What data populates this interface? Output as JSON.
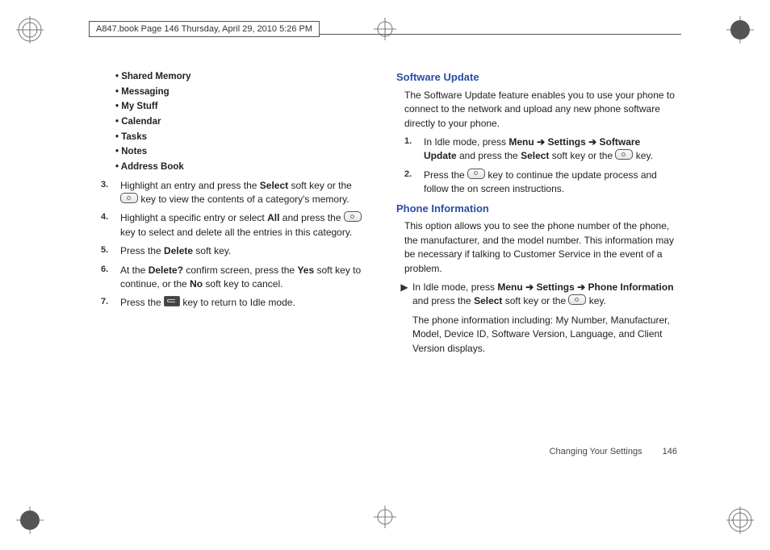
{
  "header": "A847.book  Page 146  Thursday, April 29, 2010  5:26 PM",
  "left": {
    "bullets": [
      "Shared Memory",
      "Messaging",
      "My Stuff",
      "Calendar",
      "Tasks",
      "Notes",
      "Address Book"
    ],
    "steps": {
      "s3": {
        "n": "3.",
        "a": "Highlight an entry and press the ",
        "b": "Select",
        "c": " soft key or the ",
        "d": " key to view the contents of a category's memory."
      },
      "s4": {
        "n": "4.",
        "a": "Highlight a specific entry or select ",
        "b": "All",
        "c": " and press the ",
        "d": " key to select and delete all the entries in this category."
      },
      "s5": {
        "n": "5.",
        "a": "Press the ",
        "b": "Delete",
        "c": " soft key."
      },
      "s6": {
        "n": "6.",
        "a": "At the ",
        "b": "Delete?",
        "c": " confirm screen, press the ",
        "d": "Yes",
        "e": " soft key to continue, or the ",
        "f": "No",
        "g": " soft key to cancel."
      },
      "s7": {
        "n": "7.",
        "a": "Press the ",
        "b": " key to return to Idle mode."
      }
    }
  },
  "right": {
    "h1": "Software Update",
    "p1": "The Software Update feature enables you to use your phone to connect to the network and upload any new phone software directly to your phone.",
    "su": {
      "s1": {
        "n": "1.",
        "a": "In Idle mode, press ",
        "m": "Menu",
        "arr": " ➔ ",
        "s": "Settings",
        "sw1": "Software",
        "sw2": "Update",
        "b": " and press the ",
        "sel": "Select",
        "c": " soft key or the ",
        "d": " key."
      },
      "s2": {
        "n": "2.",
        "a": "Press the ",
        "b": " key to continue the update process and follow the on screen instructions."
      }
    },
    "h2": "Phone Information",
    "p2": "This option allows you to see the phone number of the phone, the manufacturer, and the model number. This information may be necessary if talking to Customer Service in the event of a problem.",
    "pi": {
      "a": "In Idle mode, press ",
      "m": "Menu",
      "arr": " ➔ ",
      "s": "Settings",
      "ph": "Phone Information",
      "b": " and press the ",
      "sel": "Select",
      "c": " soft key or the ",
      "d": " key.",
      "e": "The phone information including: My Number, Manufacturer, Model, Device ID, Software Version, Language, and Client Version displays."
    }
  },
  "footer": {
    "section": "Changing Your Settings",
    "page": "146"
  }
}
